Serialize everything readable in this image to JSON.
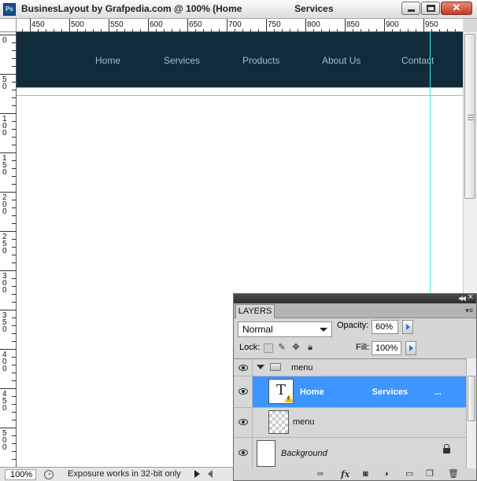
{
  "window": {
    "title": "BusinesLayout by Grafpedia.com @ 100% (Home                    Services",
    "app_icon_label": "Ps"
  },
  "rulers": {
    "horizontal": [
      "450",
      "500",
      "550",
      "600",
      "650",
      "700",
      "750",
      "800",
      "850",
      "900",
      "950"
    ],
    "vertical": [
      "0",
      "50",
      "100",
      "150",
      "200",
      "250",
      "300",
      "350",
      "400",
      "450",
      "500"
    ]
  },
  "canvas": {
    "nav": [
      "Home",
      "Services",
      "Products",
      "About Us",
      "Contact"
    ],
    "colors": {
      "menu_background": "#102c3b",
      "nav_text": "#aab9c4",
      "guide": "#3ee6ee"
    }
  },
  "statusbar": {
    "zoom": "100%",
    "message": "Exposure works in 32-bit only"
  },
  "layers_panel": {
    "tab_label": "LAYERS",
    "blend_mode": "Normal",
    "opacity_label": "Opacity:",
    "opacity_value": "60%",
    "lock_label": "Lock:",
    "fill_label": "Fill:",
    "fill_value": "100%",
    "layers": [
      {
        "name": "menu",
        "kind": "group",
        "expanded": true
      },
      {
        "name": "Home                    Services           ...",
        "kind": "text",
        "selected": true
      },
      {
        "name": "menu",
        "kind": "pixel"
      },
      {
        "name": "Background",
        "kind": "background",
        "locked": true
      }
    ],
    "footer_icons": [
      "link-icon",
      "fx-icon",
      "mask-icon",
      "adjustment-icon",
      "new-group-icon",
      "new-layer-icon",
      "trash-icon"
    ],
    "colors": {
      "selection": "#3d95ff"
    }
  }
}
